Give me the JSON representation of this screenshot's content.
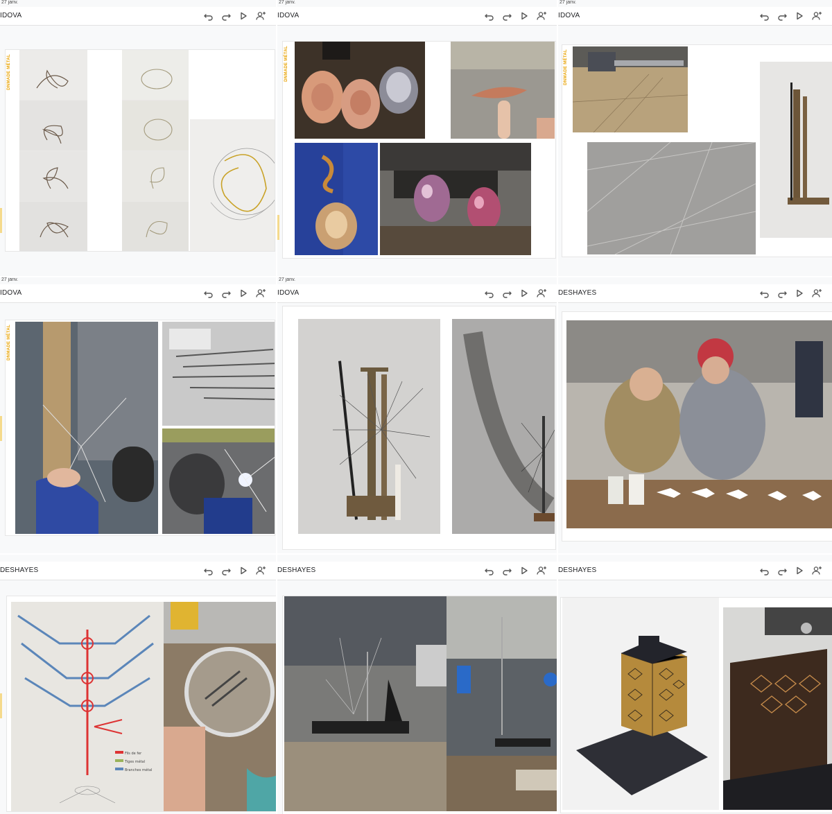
{
  "tiles": [
    {
      "date": "27 janv.",
      "name": "IDOVA"
    },
    {
      "date": "27 janv.",
      "name": "IDOVA"
    },
    {
      "date": "27 janv.",
      "name": "IDOVA"
    },
    {
      "date": "27 janv.",
      "name": "IDOVA"
    },
    {
      "date": "27 janv.",
      "name": "IDOVA"
    },
    {
      "date": "",
      "name": "DESHAYES"
    },
    {
      "date": "",
      "name": "DESHAYES"
    },
    {
      "date": "",
      "name": "DESHAYES"
    },
    {
      "date": "",
      "name": "DESHAYES"
    }
  ],
  "brand": "DNMADE MÉTAL",
  "toolbar_icons": [
    "undo-icon",
    "redo-icon",
    "play-icon",
    "add-person-icon"
  ],
  "legend": [
    "Fils de fer",
    "Tiges métal",
    "Branches métal"
  ],
  "colors": {
    "brand": "#e8a200",
    "toolbar_bg": "#ffffff",
    "tile_bg": "#f8f9fa"
  }
}
